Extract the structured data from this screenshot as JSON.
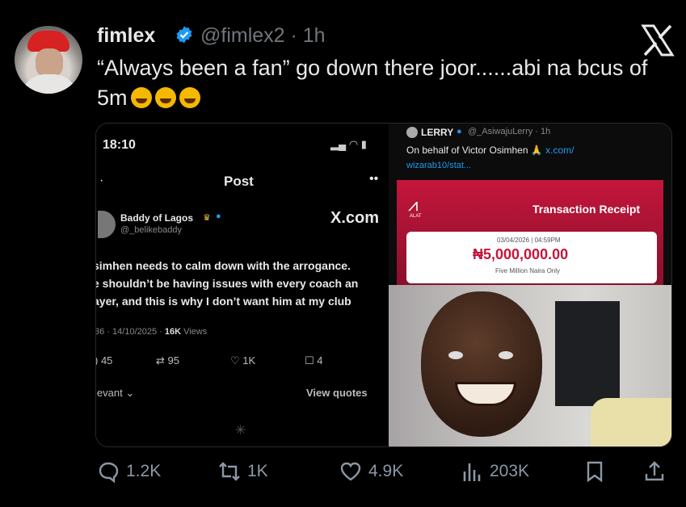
{
  "tweet": {
    "display_name": "fimlex",
    "handle_time": "@fimlex2 · 1h",
    "text": "“Always been a fan” go down there joor......abi na bcus of 5m",
    "emoji_count": 3
  },
  "screenshot_left": {
    "status_time": "18:10",
    "header_title": "Post",
    "author_name": "Baddy of Lagos",
    "author_handle": "@_belikebaddy",
    "brand_text": "X.com",
    "lines": [
      "simhen needs to calm down with the arrogance.",
      "e shouldn’t be having issues with every coach an",
      "ayer, and this is why I don’t want him at my club"
    ],
    "date_line": "36 · 14/10/2025 · ",
    "views_count": "16K",
    "views_label": " Views",
    "counts": {
      "replies": "45",
      "reposts": "95",
      "likes": "1K",
      "bookmarks": "4"
    },
    "relevant_label": "levant",
    "view_quotes": "View quotes"
  },
  "screenshot_right": {
    "author": "LERRY",
    "handle_time": "@_AsiwajuLerry · 1h",
    "line1": "On behalf of Victor Osimhen",
    "link1": " x.com/",
    "link2": "wizarab10/stat...",
    "bank_label": "ALAT",
    "receipt_title": "Transaction Receipt",
    "receipt_date": "03/04/2026 | 04:59PM",
    "amount": "₦5,000,000.00",
    "amount_words": "Five Million Naira Only"
  },
  "actions": {
    "replies": "1.2K",
    "reposts": "1K",
    "likes": "4.9K",
    "views": "203K"
  },
  "colors": {
    "background": "#000000",
    "muted": "#71767b",
    "verified": "#1d9bf0",
    "receipt_red": "#c4163b"
  }
}
